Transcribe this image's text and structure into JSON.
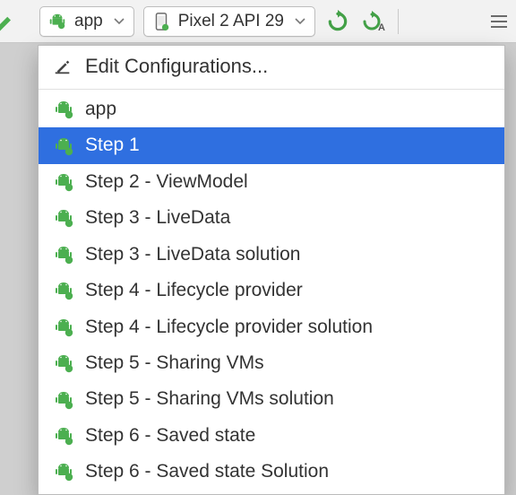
{
  "toolbar": {
    "config_selector": {
      "label": "app"
    },
    "device_selector": {
      "label": "Pixel 2 API 29"
    }
  },
  "dropdown": {
    "edit_label": "Edit Configurations...",
    "items": [
      {
        "label": "app",
        "selected": false
      },
      {
        "label": "Step 1",
        "selected": true
      },
      {
        "label": "Step 2 - ViewModel",
        "selected": false
      },
      {
        "label": "Step 3 - LiveData",
        "selected": false
      },
      {
        "label": "Step 3 - LiveData solution",
        "selected": false
      },
      {
        "label": "Step 4 - Lifecycle provider",
        "selected": false
      },
      {
        "label": "Step 4 - Lifecycle provider solution",
        "selected": false
      },
      {
        "label": "Step 5 - Sharing VMs",
        "selected": false
      },
      {
        "label": "Step 5 - Sharing VMs solution",
        "selected": false
      },
      {
        "label": "Step 6 - Saved state",
        "selected": false
      },
      {
        "label": "Step 6 - Saved state Solution",
        "selected": false
      }
    ]
  },
  "icons": {
    "android": "android-icon",
    "phone": "phone-icon",
    "chevron": "chevron-down-icon",
    "run_restart": "run-restart-icon",
    "run_restart_activity": "run-restart-activity-icon",
    "edit_pencil": "edit-pencil-icon",
    "hammer": "hammer-icon"
  },
  "colors": {
    "accent_blue": "#2f6fe0",
    "android_green": "#4caf50",
    "run_green": "#43a047"
  }
}
